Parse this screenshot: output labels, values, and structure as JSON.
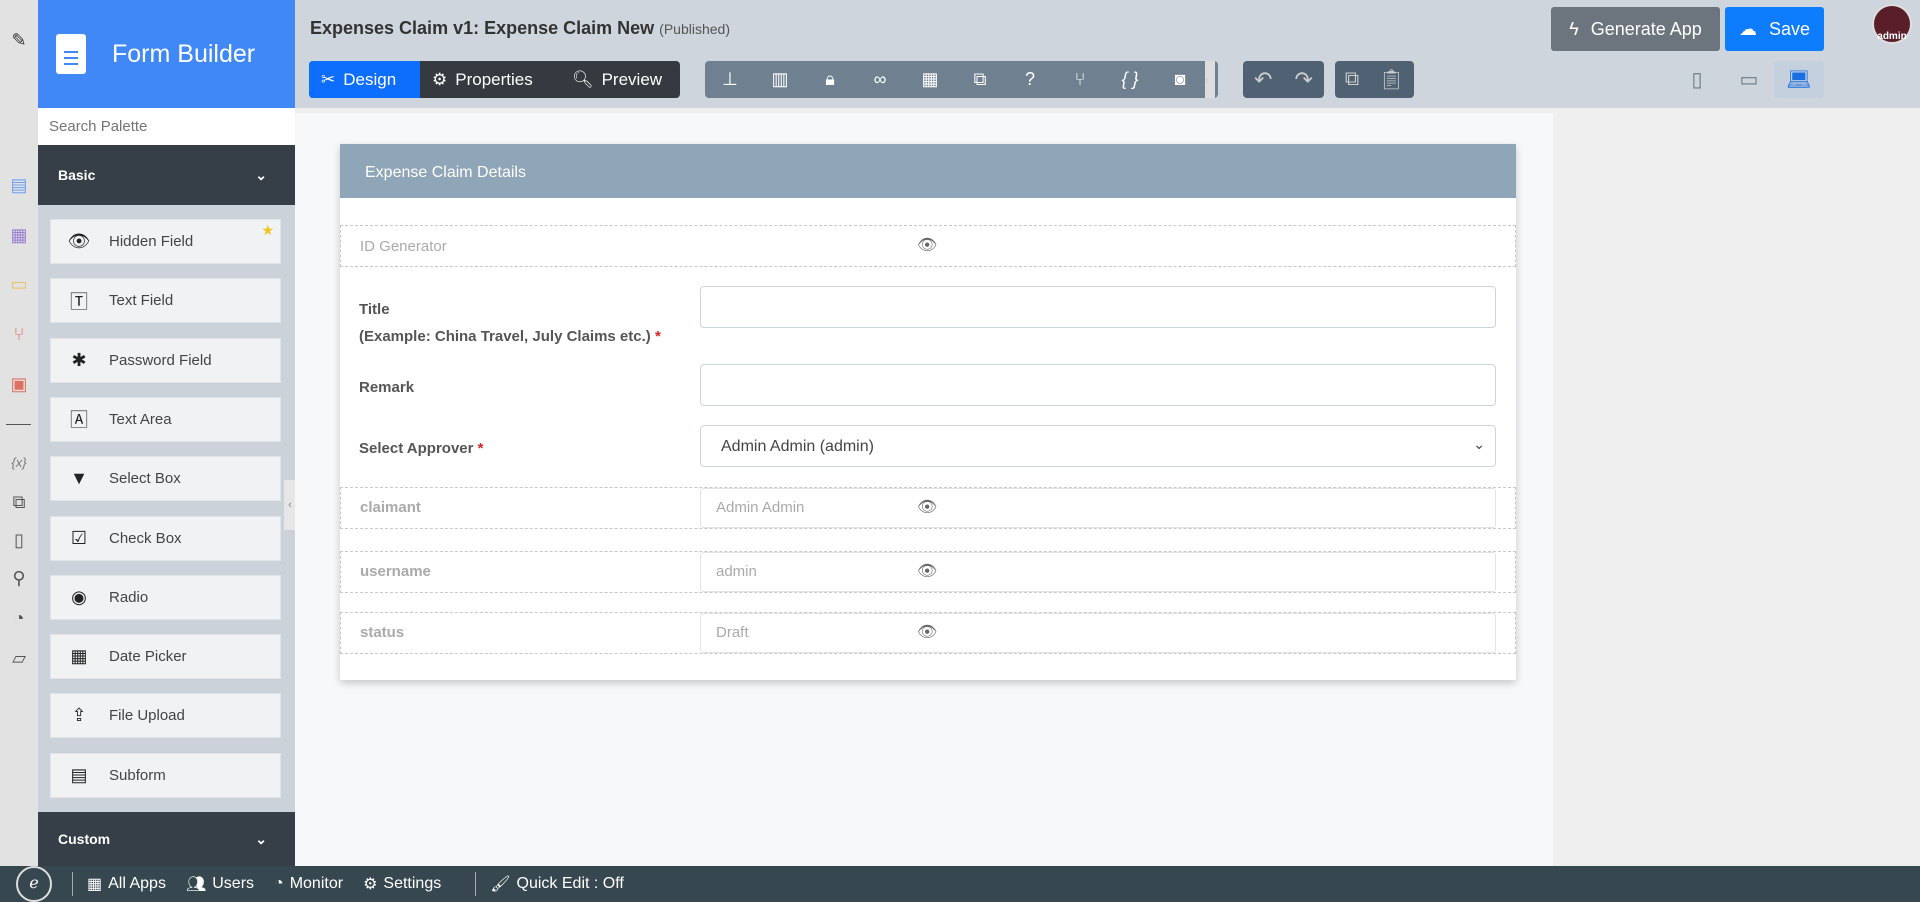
{
  "palette": {
    "title": "Form Builder",
    "search_placeholder": "Search Palette",
    "sections": {
      "basic": "Basic",
      "custom": "Custom"
    },
    "items": [
      {
        "label": "Hidden Field",
        "icon": "eye-slash-icon"
      },
      {
        "label": "Text Field",
        "icon": "text-field-icon"
      },
      {
        "label": "Password Field",
        "icon": "asterisk-icon"
      },
      {
        "label": "Text Area",
        "icon": "text-area-icon"
      },
      {
        "label": "Select Box",
        "icon": "select-box-icon"
      },
      {
        "label": "Check Box",
        "icon": "checkbox-icon"
      },
      {
        "label": "Radio",
        "icon": "radio-icon"
      },
      {
        "label": "Date Picker",
        "icon": "calendar-icon"
      },
      {
        "label": "File Upload",
        "icon": "upload-icon"
      },
      {
        "label": "Subform",
        "icon": "subform-icon"
      }
    ]
  },
  "header": {
    "title": "Expenses Claim v1: Expense Claim New",
    "status": "(Published)",
    "tabs": {
      "design": "Design",
      "properties": "Properties",
      "preview": "Preview"
    },
    "generate": "Generate App",
    "save": "Save",
    "avatar": "admin"
  },
  "form": {
    "section_title": "Expense Claim Details",
    "id_generator": "ID Generator",
    "title_label": "Title",
    "title_hint": "(Example: China Travel, July Claims etc.)",
    "remark_label": "Remark",
    "approver_label": "Select Approver",
    "approver_value": "Admin Admin (admin)",
    "hidden": [
      {
        "label": "claimant",
        "value": "Admin Admin"
      },
      {
        "label": "username",
        "value": "admin"
      },
      {
        "label": "status",
        "value": "Draft"
      }
    ]
  },
  "footer": {
    "all_apps": "All Apps",
    "users": "Users",
    "monitor": "Monitor",
    "settings": "Settings",
    "quick_edit": "Quick Edit : Off"
  },
  "colors": {
    "brand": "#3f88f5",
    "active": "#0d6efd",
    "dark": "#363f47"
  }
}
